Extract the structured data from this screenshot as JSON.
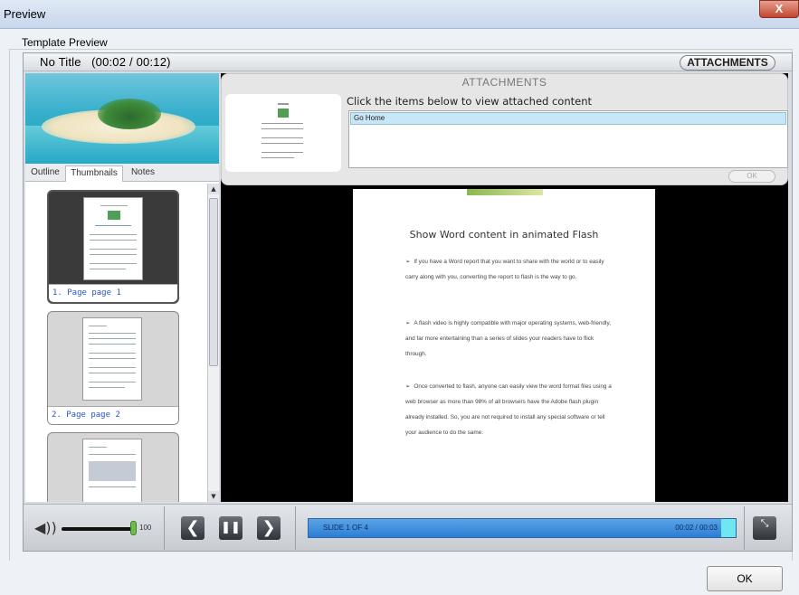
{
  "window": {
    "title": "Preview",
    "close_glyph": "X"
  },
  "group": {
    "label": "Template Preview"
  },
  "player": {
    "title": "No Title",
    "time": "(00:02 / 00:12)",
    "attachments_button": "ATTACHMENTS"
  },
  "sidebar": {
    "tabs": [
      "Outline",
      "Thumbnails",
      "Notes"
    ],
    "active_tab": "Thumbnails",
    "thumbnails": [
      {
        "caption": "1. Page page 1"
      },
      {
        "caption": "2. Page page 2"
      },
      {
        "caption": ""
      }
    ]
  },
  "attachments": {
    "title": "ATTACHMENTS",
    "instruction": "Click the items below to view attached content",
    "items": [
      "Go Home"
    ],
    "ok_label": "OK"
  },
  "slide": {
    "title": "Show Word content in animated Flash",
    "bullets": [
      "If you have a Word report that you want to share with the world or to easily carry along with you, converting the report to flash is the way to go.",
      "A flash video is highly compatible with major operating systems, web-friendly, and far more entertaining than a series of slides your readers have to flick through.",
      "Once converted to flash, anyone can easily view the word format files using a web browser as more than 98% of all browsers have the Adobe flash plugin already installed. So, you are not required to install any special software or tell your audience to do the same."
    ],
    "bullet_marker": "➢"
  },
  "controls": {
    "volume": "100",
    "volume_level": 1.0,
    "slide_label": "SLIDE 1 OF 4",
    "progress_time": "00:02 / 00:03",
    "prev_glyph": "❮",
    "pause_glyph": "❚❚",
    "next_glyph": "❯",
    "volume_glyph": "◀))",
    "fullscreen_glyph": "⤡"
  },
  "footer": {
    "ok_label": "OK"
  },
  "colors": {
    "progress_blue": "#2d7ed4",
    "progress_end": "#6ee7f0",
    "selected_item": "#c8e6f5",
    "thumb_caption": "#2a55c8"
  }
}
